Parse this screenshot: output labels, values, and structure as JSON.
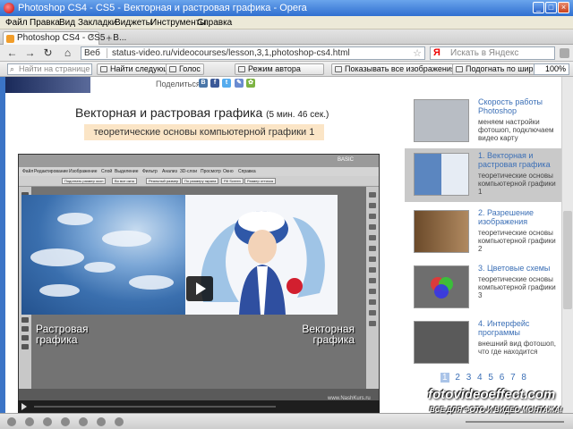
{
  "window": {
    "title": "Photoshop CS4 - CS5 - Векторная и растровая графика - Opera"
  },
  "menu": [
    "Файл",
    "Правка",
    "Вид",
    "Закладки",
    "Виджеты",
    "Инструменты",
    "Справка"
  ],
  "tab": {
    "label": "Photoshop CS4 - CS5 - В..."
  },
  "address": {
    "web_label": "Веб",
    "url": "status-video.ru/videocourses/lesson,3,1,photoshop-cs4.html",
    "search_placeholder": "Искать в Яндекс",
    "search_engine_glyph": "Я"
  },
  "toolbar": {
    "find_placeholder": "Найти на странице",
    "find_next": "Найти следующее",
    "voice": "Голос",
    "author_mode": "Режим автора",
    "show_images": "Показывать все изображения",
    "fit_width": "Подогнать по ширине",
    "zoom": "100%"
  },
  "page": {
    "share_label": "Поделиться:",
    "lesson_title": "Векторная и растровая графика",
    "lesson_duration": "(5 мин. 46 сек.)",
    "lesson_subtitle": "теоретические основы компьютерной графики 1"
  },
  "video": {
    "menu": [
      "Файл",
      "Редактирование",
      "Изображение",
      "Слой",
      "Выделение",
      "Фильтр",
      "Анализ",
      "3D-слои",
      "Просмотр",
      "Окно",
      "Справка"
    ],
    "options": [
      "Подогнать размер окон",
      "Во все окна",
      "Реальный размер",
      "По размеру экрана",
      "Fill Screen",
      "Размер оттиска"
    ],
    "basic_label": "BASIC",
    "raster_label": "Растровая графика",
    "vector_label": "Векторная графика",
    "watermark": "www.NashKurs.ru"
  },
  "sidebar": {
    "lessons": [
      {
        "title": "Скорость работы Photoshop",
        "desc": "меняем настройки фотошоп, подключаем видео карту",
        "active": false
      },
      {
        "title": "1. Векторная и растровая графика",
        "desc": "теоретические основы компьютерной графики 1",
        "active": true
      },
      {
        "title": "2. Разрешение изображения",
        "desc": "теоретические основы компьютерной графики 2",
        "active": false
      },
      {
        "title": "3. Цветовые схемы",
        "desc": "теоретические основы компьютерной графики 3",
        "active": false
      },
      {
        "title": "4. Интерфейс программы",
        "desc": "внешний вид фотошоп, что где находится",
        "active": false
      }
    ],
    "pages": [
      "1",
      "2",
      "3",
      "4",
      "5",
      "6",
      "7",
      "8"
    ],
    "current_page": "1"
  },
  "watermark": {
    "site": "fotovideoeffect.com",
    "slogan": "ВСЕ ДЛЯ ФОТО И ВИДЕО МОНТАЖА!"
  }
}
